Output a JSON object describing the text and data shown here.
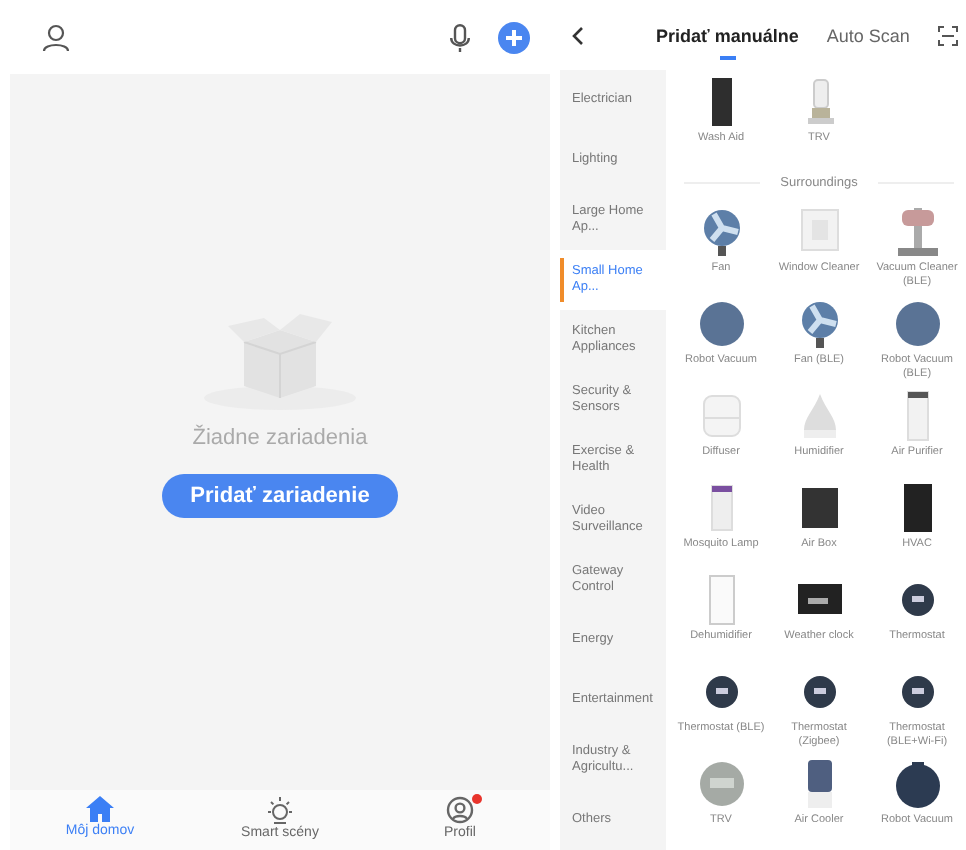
{
  "home": {
    "empty_text": "Žiadne zariadenia",
    "add_button": "Pridať zariadenie",
    "tabs": [
      {
        "label": "Môj domov",
        "selected": true,
        "kind": "home",
        "badge": false
      },
      {
        "label": "Smart scény",
        "selected": false,
        "kind": "sun",
        "badge": false
      },
      {
        "label": "Profil",
        "selected": false,
        "kind": "profile",
        "badge": true
      }
    ]
  },
  "add_device": {
    "tabs": [
      {
        "label": "Pridať manuálne",
        "selected": true
      },
      {
        "label": "Auto Scan",
        "selected": false
      }
    ],
    "categories": [
      {
        "label": "Electrician",
        "selected": false
      },
      {
        "label": "Lighting",
        "selected": false
      },
      {
        "label": "Large Home Ap...",
        "selected": false
      },
      {
        "label": "Small Home Ap...",
        "selected": true
      },
      {
        "label": "Kitchen Appliances",
        "selected": false
      },
      {
        "label": "Security & Sensors",
        "selected": false
      },
      {
        "label": "Exercise & Health",
        "selected": false
      },
      {
        "label": "Video Surveillance",
        "selected": false
      },
      {
        "label": "Gateway Control",
        "selected": false
      },
      {
        "label": "Energy",
        "selected": false
      },
      {
        "label": "Entertainment",
        "selected": false
      },
      {
        "label": "Industry & Agricultu...",
        "selected": false
      },
      {
        "label": "Others",
        "selected": false
      }
    ],
    "sections": [
      {
        "devices": [
          {
            "name": "Wash Aid",
            "kind": "panel"
          },
          {
            "name": "TRV",
            "kind": "valve"
          }
        ]
      },
      {
        "title": "Surroundings",
        "devices": [
          {
            "name": "Fan",
            "kind": "fan"
          },
          {
            "name": "Window Cleaner",
            "kind": "window"
          },
          {
            "name": "Vacuum Cleaner (BLE)",
            "kind": "stick"
          },
          {
            "name": "Robot Vacuum",
            "kind": "disc"
          },
          {
            "name": "Fan (BLE)",
            "kind": "fan"
          },
          {
            "name": "Robot Vacuum (BLE)",
            "kind": "disc"
          },
          {
            "name": "Diffuser",
            "kind": "box"
          },
          {
            "name": "Humidifier",
            "kind": "drop"
          },
          {
            "name": "Air Purifier",
            "kind": "tower"
          },
          {
            "name": "Mosquito Lamp",
            "kind": "lamp"
          },
          {
            "name": "Air Box",
            "kind": "screen"
          },
          {
            "name": "HVAC",
            "kind": "tallscreen"
          },
          {
            "name": "Dehumidifier",
            "kind": "tower2"
          },
          {
            "name": "Weather clock",
            "kind": "clock"
          },
          {
            "name": "Thermostat",
            "kind": "thermostat"
          },
          {
            "name": "Thermostat (BLE)",
            "kind": "thermostat"
          },
          {
            "name": "Thermostat (Zigbee)",
            "kind": "thermostat"
          },
          {
            "name": "Thermostat (BLE+Wi-Fi)",
            "kind": "thermostat"
          },
          {
            "name": "TRV",
            "kind": "gauge"
          },
          {
            "name": "Air Cooler",
            "kind": "cooler"
          },
          {
            "name": "Robot Vacuum",
            "kind": "robot"
          }
        ]
      }
    ]
  }
}
